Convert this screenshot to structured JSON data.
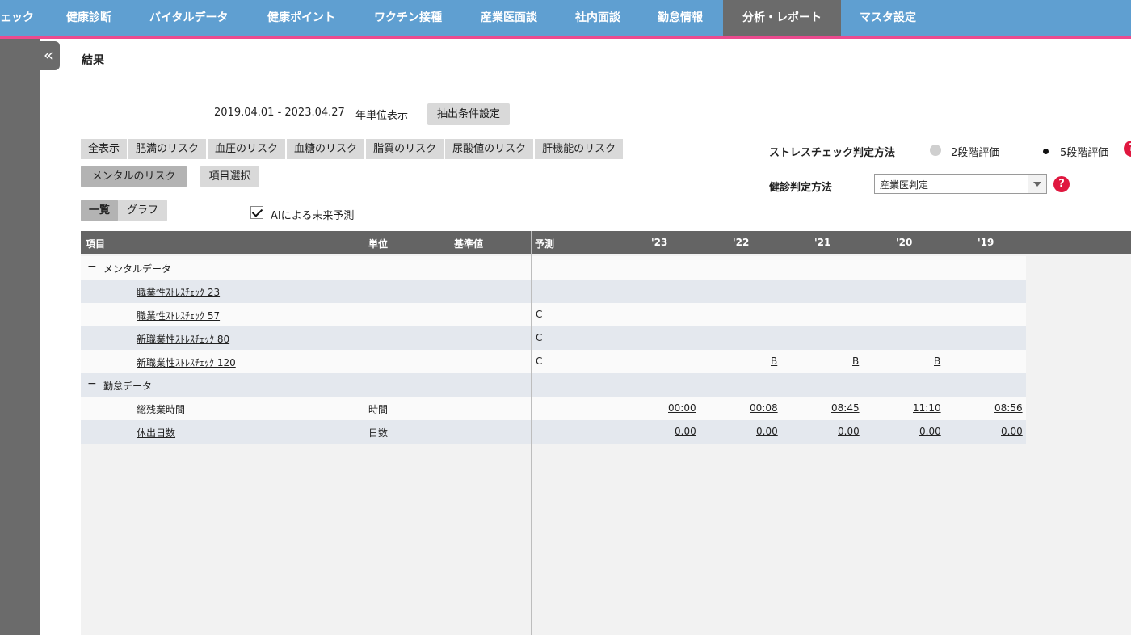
{
  "nav": {
    "items": [
      "ェック",
      "健康診断",
      "バイタルデータ",
      "健康ポイント",
      "ワクチン接種",
      "産業医面談",
      "社内面談",
      "勤怠情報",
      "分析・レポート",
      "マスタ設定"
    ],
    "active": "分析・レポート"
  },
  "page": {
    "title": "結果",
    "collapse_glyph": "«",
    "date_range": "2019.04.01 - 2023.04.27",
    "year_label": "年単位表示",
    "extract_button": "抽出条件設定"
  },
  "filters": [
    "全表示",
    "肥満のリスク",
    "血圧のリスク",
    "血糖のリスク",
    "脂質のリスク",
    "尿酸値のリスク",
    "肝機能のリスク"
  ],
  "mental_button": "メンタルのリスク",
  "item_select_button": "項目選択",
  "view_toggle": {
    "list": "一覧",
    "graph": "グラフ"
  },
  "ai_label": "AIによる未来予測",
  "ai_checked": true,
  "stress": {
    "label": "ストレスチェック判定方法",
    "option_2": "2段階評価",
    "option_5": "5段階評価",
    "selected": "5段階評価"
  },
  "kenshin": {
    "label": "健診判定方法",
    "value": "産業医判定"
  },
  "help_glyph": "?",
  "table": {
    "headers": {
      "item": "項目",
      "unit": "単位",
      "standard": "基準値",
      "forecast": "予測",
      "years": [
        "'23",
        "'22",
        "'21",
        "'20",
        "'19"
      ]
    },
    "groups": [
      {
        "name": "メンタルデータ",
        "rows": [
          {
            "name": "職業性ｽﾄﾚｽﾁｪｯｸ 23",
            "unit": "",
            "forecast": "",
            "values": [
              "",
              "",
              "",
              "",
              ""
            ]
          },
          {
            "name": "職業性ｽﾄﾚｽﾁｪｯｸ 57",
            "unit": "",
            "forecast": "C",
            "values": [
              "",
              "",
              "",
              "",
              ""
            ]
          },
          {
            "name": "新職業性ｽﾄﾚｽﾁｪｯｸ 80",
            "unit": "",
            "forecast": "C",
            "values": [
              "",
              "",
              "",
              "",
              ""
            ]
          },
          {
            "name": "新職業性ｽﾄﾚｽﾁｪｯｸ 120",
            "unit": "",
            "forecast": "C",
            "values": [
              "",
              "B",
              "B",
              "B",
              ""
            ]
          }
        ]
      },
      {
        "name": "勤怠データ",
        "rows": [
          {
            "name": "総残業時間",
            "unit": "時間",
            "forecast": "",
            "values": [
              "00:00",
              "00:08",
              "08:45",
              "11:10",
              "08:56"
            ]
          },
          {
            "name": "休出日数",
            "unit": "日数",
            "forecast": "",
            "values": [
              "0.00",
              "0.00",
              "0.00",
              "0.00",
              "0.00"
            ]
          }
        ]
      }
    ]
  }
}
